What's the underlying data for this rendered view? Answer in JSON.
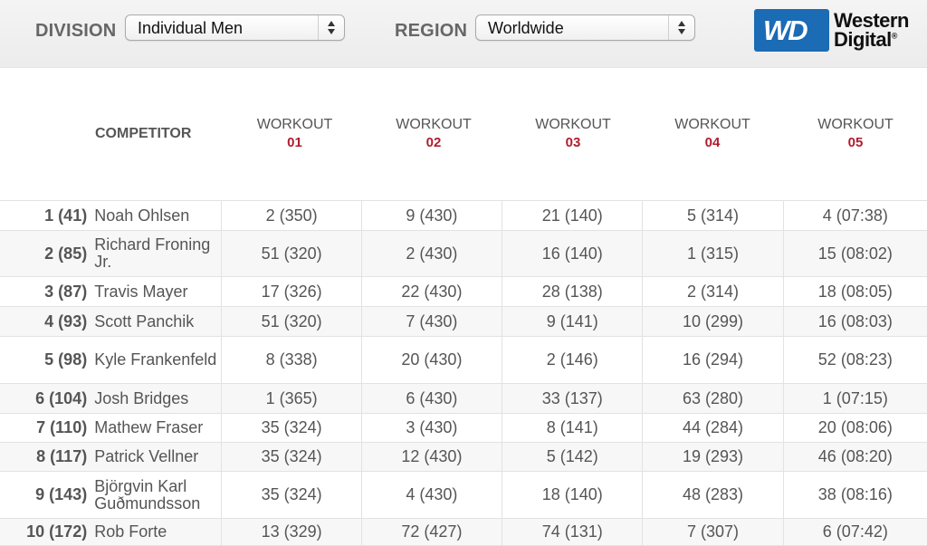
{
  "filters": {
    "division_label": "DIVISION",
    "division_value": "Individual Men",
    "region_label": "REGION",
    "region_value": "Worldwide"
  },
  "logo": {
    "badge": "WD",
    "line1": "Western",
    "line2": "Digital",
    "reg": "®"
  },
  "table": {
    "competitor_header": "COMPETITOR",
    "workouts": [
      {
        "label": "WORKOUT",
        "num": "01"
      },
      {
        "label": "WORKOUT",
        "num": "02"
      },
      {
        "label": "WORKOUT",
        "num": "03"
      },
      {
        "label": "WORKOUT",
        "num": "04"
      },
      {
        "label": "WORKOUT",
        "num": "05"
      }
    ],
    "rows": [
      {
        "rank": "1 (41)",
        "name": "Noah Ohlsen",
        "scores": [
          "2 (350)",
          "9 (430)",
          "21 (140)",
          "5 (314)",
          "4 (07:38)"
        ]
      },
      {
        "rank": "2 (85)",
        "name": "Richard Froning Jr.",
        "scores": [
          "51 (320)",
          "2 (430)",
          "16 (140)",
          "1 (315)",
          "15 (08:02)"
        ]
      },
      {
        "rank": "3 (87)",
        "name": "Travis Mayer",
        "scores": [
          "17 (326)",
          "22 (430)",
          "28 (138)",
          "2 (314)",
          "18 (08:05)"
        ]
      },
      {
        "rank": "4 (93)",
        "name": "Scott Panchik",
        "scores": [
          "51 (320)",
          "7 (430)",
          "9 (141)",
          "10 (299)",
          "16 (08:03)"
        ]
      },
      {
        "rank": "5 (98)",
        "name": "Kyle Frankenfeld",
        "scores": [
          "8 (338)",
          "20 (430)",
          "2 (146)",
          "16 (294)",
          "52 (08:23)"
        ]
      },
      {
        "rank": "6 (104)",
        "name": "Josh Bridges",
        "scores": [
          "1 (365)",
          "6 (430)",
          "33 (137)",
          "63 (280)",
          "1 (07:15)"
        ]
      },
      {
        "rank": "7 (110)",
        "name": "Mathew Fraser",
        "scores": [
          "35 (324)",
          "3 (430)",
          "8 (141)",
          "44 (284)",
          "20 (08:06)"
        ]
      },
      {
        "rank": "8 (117)",
        "name": "Patrick Vellner",
        "scores": [
          "35 (324)",
          "12 (430)",
          "5 (142)",
          "19 (293)",
          "46 (08:20)"
        ]
      },
      {
        "rank": "9 (143)",
        "name": "Björgvin Karl Guðmundsson",
        "scores": [
          "35 (324)",
          "4 (430)",
          "18 (140)",
          "48 (283)",
          "38 (08:16)"
        ]
      },
      {
        "rank": "10 (172)",
        "name": "Rob Forte",
        "scores": [
          "13 (329)",
          "72 (427)",
          "74 (131)",
          "7 (307)",
          "6 (07:42)"
        ]
      }
    ]
  }
}
